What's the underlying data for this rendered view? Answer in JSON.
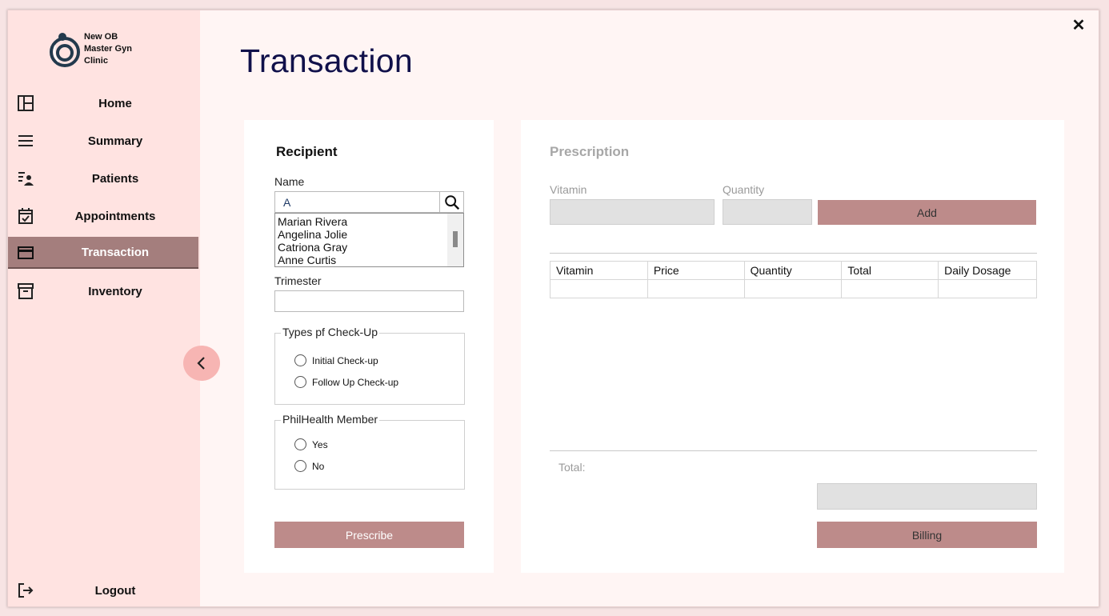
{
  "window": {
    "close_symbol": "✕"
  },
  "sidebar": {
    "brand": {
      "lines": [
        "New OB",
        "Master Gyn",
        "Clinic"
      ]
    },
    "items": [
      {
        "label": "Home",
        "icon": "dashboard-icon"
      },
      {
        "label": "Summary",
        "icon": "menu-icon"
      },
      {
        "label": "Patients",
        "icon": "patients-list-icon"
      },
      {
        "label": "Appointments",
        "icon": "calendar-check-icon"
      },
      {
        "label": "Transaction",
        "icon": "card-icon",
        "active": true
      },
      {
        "label": "Inventory",
        "icon": "archive-icon"
      }
    ],
    "logout": {
      "label": "Logout",
      "icon": "logout-icon"
    },
    "collapse_icon": "chevron-left-icon"
  },
  "page": {
    "title": "Transaction"
  },
  "recipient": {
    "heading": "Recipient",
    "name_label": "Name",
    "name_value": "A",
    "suggestions": [
      "Marian Rivera",
      "Angelina Jolie",
      "Catriona Gray",
      "Anne Curtis"
    ],
    "trimester_label": "Trimester",
    "trimester_value": "",
    "checkup_group": {
      "title": "Types pf Check-Up",
      "options": [
        "Initial Check-up",
        "Follow Up Check-up"
      ]
    },
    "philhealth_group": {
      "title": "PhilHealth Member",
      "options": [
        "Yes",
        "No"
      ]
    },
    "prescribe_label": "Prescribe"
  },
  "prescription": {
    "heading": "Prescription",
    "vitamin_label": "Vitamin",
    "quantity_label": "Quantity",
    "add_label": "Add",
    "table": {
      "columns": [
        "Vitamin",
        "Price",
        "Quantity",
        "Total",
        "Daily Dosage"
      ],
      "rows": [
        [
          "",
          "",
          "",
          "",
          ""
        ]
      ]
    },
    "total_label": "Total:",
    "total_value": "",
    "billing_label": "Billing"
  },
  "colors": {
    "sidebar_bg": "#ffe3e1",
    "active_nav": "#a47e7d",
    "accent_button": "#bd8b8a",
    "title": "#10104a"
  }
}
